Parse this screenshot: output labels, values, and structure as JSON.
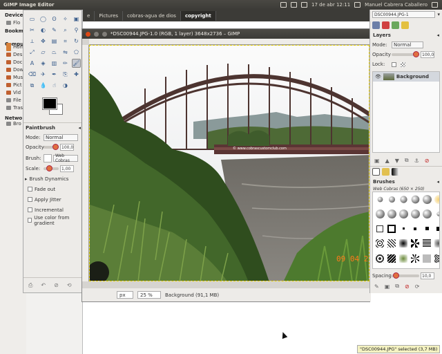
{
  "topbar": {
    "app_title": "GIMP Image Editor",
    "date_time": "17 de abr 12:11",
    "user": "Manuel Cabrera Caballero"
  },
  "nautilus": {
    "sections": [
      {
        "heading": "Device",
        "items": [
          "Flo"
        ]
      },
      {
        "heading": "Bookm",
        "items": []
      },
      {
        "heading": "Compu",
        "items": [
          "Hom",
          "Des",
          "Doc",
          "Dow",
          "Mus",
          "Pict",
          "Vid",
          "File",
          "Tras"
        ]
      },
      {
        "heading": "Netwo",
        "items": [
          "Bro"
        ]
      }
    ],
    "breadcrumbs": [
      "e",
      "Pictures",
      "cobras-agua de dios",
      "copyright"
    ]
  },
  "toolbox": {
    "tool_options_title": "Paintbrush",
    "mode_label": "Mode:",
    "mode_value": "Normal",
    "opacity_label": "Opacity",
    "opacity_value": "100,0",
    "brush_label": "Brush:",
    "brush_value": "Web Cobras",
    "scale_label": "Scale:",
    "scale_value": "1,00",
    "checks": [
      "Brush Dynamics",
      "Fade out",
      "Apply Jitter",
      "Incremental",
      "Use color from gradient"
    ]
  },
  "image_window": {
    "title": "*DSC00944.JPG-1.0 (RGB, 1 layer) 3648x2736 – GIMP",
    "watermark": "© www.cobrascustomclub.com",
    "date_stamp": "09 04 2",
    "unit": "px",
    "zoom": "25 %",
    "status": "Background (91,1 MB)"
  },
  "dock": {
    "image_select": "DSC00944.JPG-1",
    "layers_title": "Layers",
    "mode_label": "Mode:",
    "mode_value": "Normal",
    "opacity_label": "Opacity",
    "opacity_value": "100,0",
    "lock_label": "Lock:",
    "layer_name": "Background",
    "brushes_title": "Brushes",
    "brush_name": "Web Cobras (650 × 250)",
    "spacing_label": "Spacing:",
    "spacing_value": "10,0"
  },
  "tooltip": "\"DSC00944.JPG\" selected (3,7 MB)",
  "colors": {
    "accent": "#e07040",
    "topbar": "#3c3b37",
    "close": "#dd4814"
  }
}
